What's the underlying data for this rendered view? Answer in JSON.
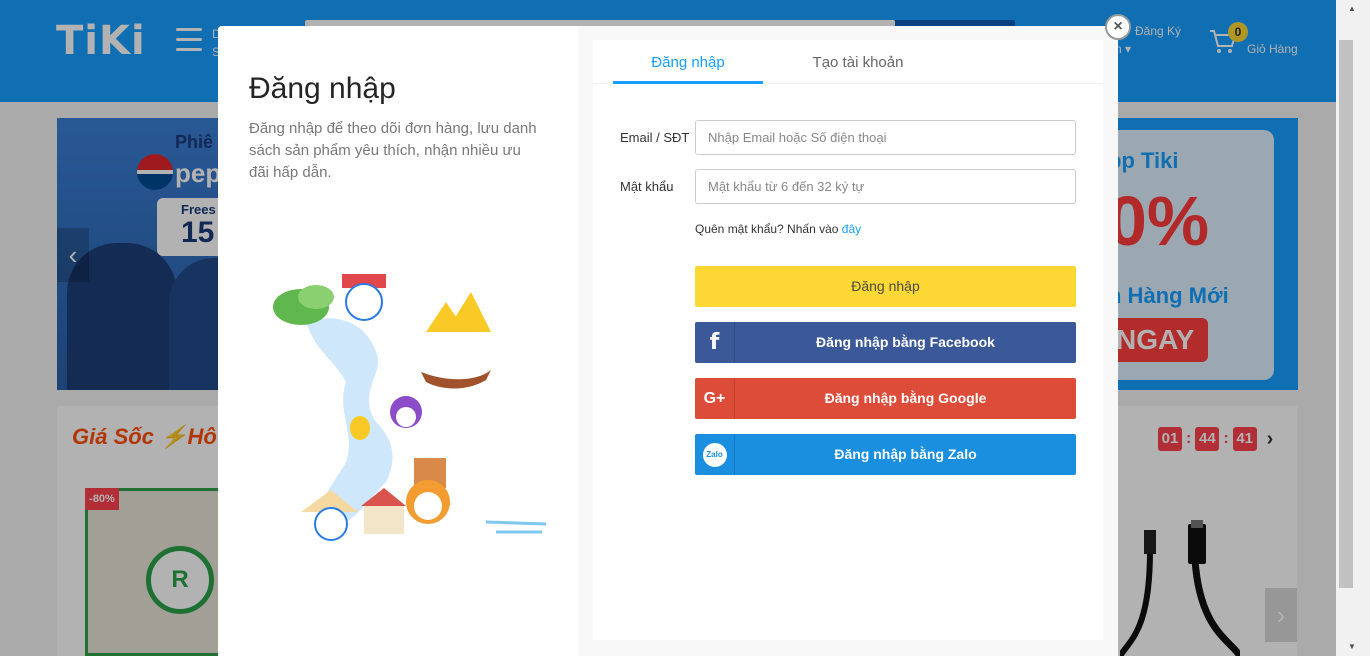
{
  "page": {
    "logo": "TiKi",
    "menu_label_lines": [
      "D",
      "S"
    ],
    "account": {
      "register": "Đăng Ký",
      "account": "n"
    },
    "cart": {
      "count": "0",
      "label": "Giỏ Hàng"
    }
  },
  "banner_left": {
    "line1": "Phiê",
    "brand": "pep",
    "box_a": "Frees",
    "box_b": "15"
  },
  "banner_right": {
    "line1": "pp Tiki",
    "big": "0%",
    "line3": "h Hàng Mới",
    "cta": "NGAY"
  },
  "deal": {
    "title": "Giá Sốc",
    "title_suffix": "Hô",
    "countdown": {
      "hours": "01",
      "minutes": "44",
      "seconds": "41",
      "sep": ":"
    },
    "discount_badge": "-80%",
    "seal_letter": "R"
  },
  "modal": {
    "title": "Đăng nhập",
    "description": "Đăng nhập để theo dõi đơn hàng, lưu danh sách sản phẩm yêu thích, nhận nhiều ưu đãi hấp dẫn.",
    "close_symbol": "×",
    "tabs": {
      "login": "Đăng nhập",
      "create": "Tạo tài khoản"
    },
    "form": {
      "email_label": "Email / SĐT",
      "email_placeholder": "Nhập Email hoặc Số điện thoại",
      "password_label": "Mật khẩu",
      "password_placeholder": "Mật khẩu từ 6 đến 32 ký tự",
      "forgot_text": "Quên mật khẩu? Nhấn vào",
      "forgot_link": "đây"
    },
    "buttons": {
      "login": "Đăng nhập",
      "facebook": "Đăng nhập bằng Facebook",
      "facebook_icon": "f",
      "google": "Đăng nhập bằng Google",
      "google_icon": "G+",
      "zalo": "Đăng nhập bằng Zalo",
      "zalo_icon": "Zalo"
    }
  },
  "colors": {
    "brand_blue": "#189eff",
    "login_yellow": "#fdd835",
    "facebook": "#3b5998",
    "google": "#dd4b39",
    "zalo": "#1a8fdf",
    "deal_red": "#ff424e"
  }
}
